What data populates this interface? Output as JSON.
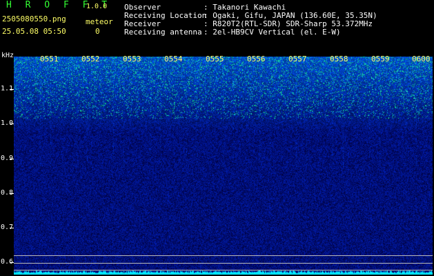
{
  "header": {
    "app_title": "H R O F F T",
    "version": "1.0.0",
    "filename": "2505080550.png",
    "timestamp": "25.05.08 05:50",
    "meteor_label": "meteor",
    "meteor_count": "0"
  },
  "info": [
    {
      "key": "Observer",
      "value": ": Takanori Kawachi"
    },
    {
      "key": "Receiving Location",
      "value": ": Ogaki, Gifu, JAPAN (136.60E, 35.35N)"
    },
    {
      "key": "Receiver",
      "value": ": R820T2(RTL-SDR) SDR-Sharp 53.372MHz"
    },
    {
      "key": "Receiving antenna",
      "value": ": 2el-HB9CV Vertical (el. E-W)"
    }
  ],
  "axis": {
    "unit": "kHz",
    "y_labels": [
      "1.1",
      "1.0",
      "0.9",
      "0.8",
      "0.7",
      "0.6"
    ],
    "time_labels": [
      "0551",
      "0552",
      "0553",
      "0554",
      "0555",
      "0556",
      "0557",
      "0558",
      "0559",
      "0600"
    ]
  },
  "colors": {
    "background": "#000000",
    "noise_floor": "#0a1a8a",
    "signal": "#33ff66",
    "baseline": "#00e5ff"
  }
}
